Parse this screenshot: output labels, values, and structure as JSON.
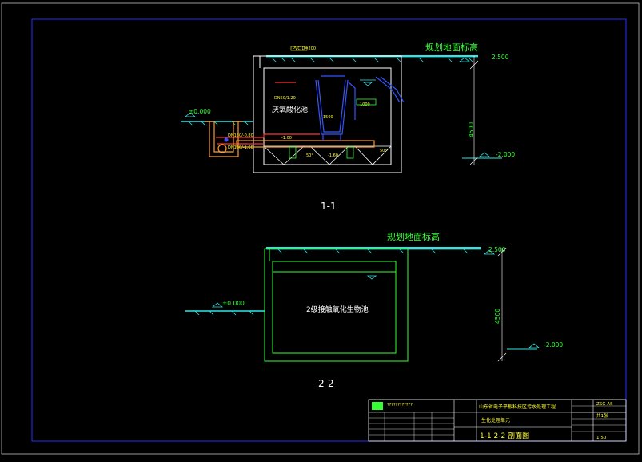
{
  "colors": {
    "background": "#000000",
    "frame": "#2b2bff",
    "structure": "#ffffff",
    "green": "#33ff33",
    "cyan": "#33e6e6",
    "yellow": "#ffff33",
    "blue": "#3355ff",
    "red": "#ff3333",
    "orange": "#ff9933"
  },
  "section_1": {
    "title": "1-1",
    "ground_label": "规划地面标高",
    "elev_top": "2.500",
    "elev_left": "±0.000",
    "elev_bottom": "-2.000",
    "depth": "4500",
    "tank_label": "厌氧酸化池",
    "pipe_pvc": "PVC D=200",
    "pipe_dn1": "DN50/1.20",
    "pipe_dn2": "DN150/-0.80",
    "pipe_dn3": "DN150/-1.60",
    "note_1": "-1.00",
    "note_2": "-1.60",
    "angle": "50°",
    "dim_1": "1500",
    "dim_2": "1000"
  },
  "section_2": {
    "title": "2-2",
    "ground_label": "规划地面标高",
    "elev_top": "2.500",
    "elev_left": "±0.000",
    "elev_bottom": "-2.000",
    "depth": "4500",
    "tank_label": "2级接触氧化生物池"
  },
  "title_block": {
    "project": "山东省电子平板科技区污水处理工程",
    "subtitle": "生化处理单元",
    "drawing_name": "1-1  2-2 剖面图",
    "code": "ZSG-AS",
    "sheet": "共1张",
    "scale": "1:50",
    "company_line": "????????????"
  }
}
